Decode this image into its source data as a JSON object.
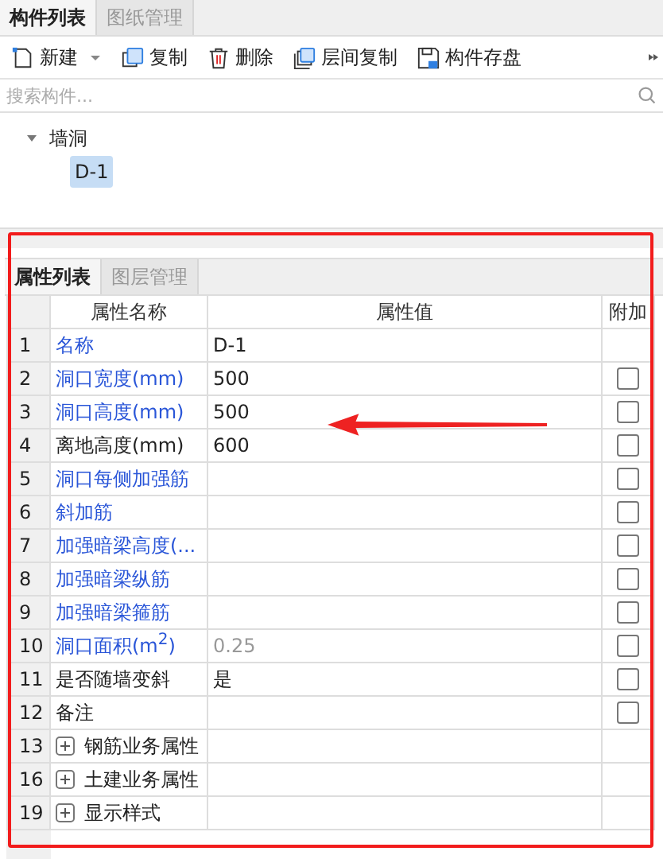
{
  "top_tabs": [
    {
      "label": "构件列表",
      "selected": true
    },
    {
      "label": "图纸管理",
      "selected": false
    }
  ],
  "toolbar": [
    {
      "label": "新建",
      "dropdown": true
    },
    {
      "label": "复制",
      "dropdown": false
    },
    {
      "label": "删除",
      "dropdown": false
    },
    {
      "label": "层间复制",
      "dropdown": false
    },
    {
      "label": "构件存盘",
      "dropdown": false
    }
  ],
  "search": {
    "placeholder": "搜索构件..."
  },
  "tree": [
    {
      "label": "墙洞",
      "expanded": true,
      "selected": false,
      "children": [
        {
          "label": "D-1",
          "selected": true
        }
      ]
    }
  ],
  "bottom_tabs": [
    {
      "label": "属性列表",
      "selected": true
    },
    {
      "label": "图层管理",
      "selected": false
    }
  ],
  "table": {
    "columns": [
      "属性名称",
      "属性值",
      "附加"
    ],
    "rows": [
      {
        "kind": "property",
        "number": "1",
        "name": "名称",
        "value": "D-1",
        "public": true,
        "readonly": false
      },
      {
        "kind": "property",
        "number": "2",
        "name": "洞口宽度(mm)",
        "value": "500",
        "public": true,
        "readonly": false,
        "checked": false
      },
      {
        "kind": "property",
        "number": "3",
        "name": "洞口高度(mm)",
        "value": "500",
        "public": true,
        "readonly": false,
        "checked": false
      },
      {
        "kind": "property",
        "number": "4",
        "name": "离地高度(mm)",
        "value": "600",
        "public": false,
        "readonly": false,
        "checked": false
      },
      {
        "kind": "property",
        "number": "5",
        "name": "洞口每侧加强筋",
        "public": true,
        "checked": false
      },
      {
        "kind": "property",
        "number": "6",
        "name": "斜加筋",
        "public": true,
        "checked": false
      },
      {
        "kind": "property",
        "number": "7",
        "name": "加强暗梁高度(...",
        "public": true,
        "checked": false
      },
      {
        "kind": "property",
        "number": "8",
        "name": "加强暗梁纵筋",
        "public": true,
        "checked": false
      },
      {
        "kind": "property",
        "number": "9",
        "name": "加强暗梁箍筋",
        "public": true,
        "checked": false
      },
      {
        "kind": "property",
        "number": "10",
        "name": "洞口面积(m$^{2}$)",
        "value": "0.25",
        "public": true,
        "readonly": true,
        "checked": false
      },
      {
        "kind": "property",
        "number": "11",
        "name": "是否随墙变斜",
        "value": "是",
        "public": false,
        "readonly": false,
        "checked": false
      },
      {
        "kind": "property",
        "number": "12",
        "name": "备注",
        "public": false,
        "checked": false
      },
      {
        "kind": "group",
        "number": "13",
        "name": "钢筋业务属性",
        "expanded": false
      },
      {
        "kind": "group",
        "number": "16",
        "name": "土建业务属性",
        "expanded": false
      },
      {
        "kind": "group",
        "number": "19",
        "name": "显示样式",
        "expanded": false
      }
    ]
  }
}
